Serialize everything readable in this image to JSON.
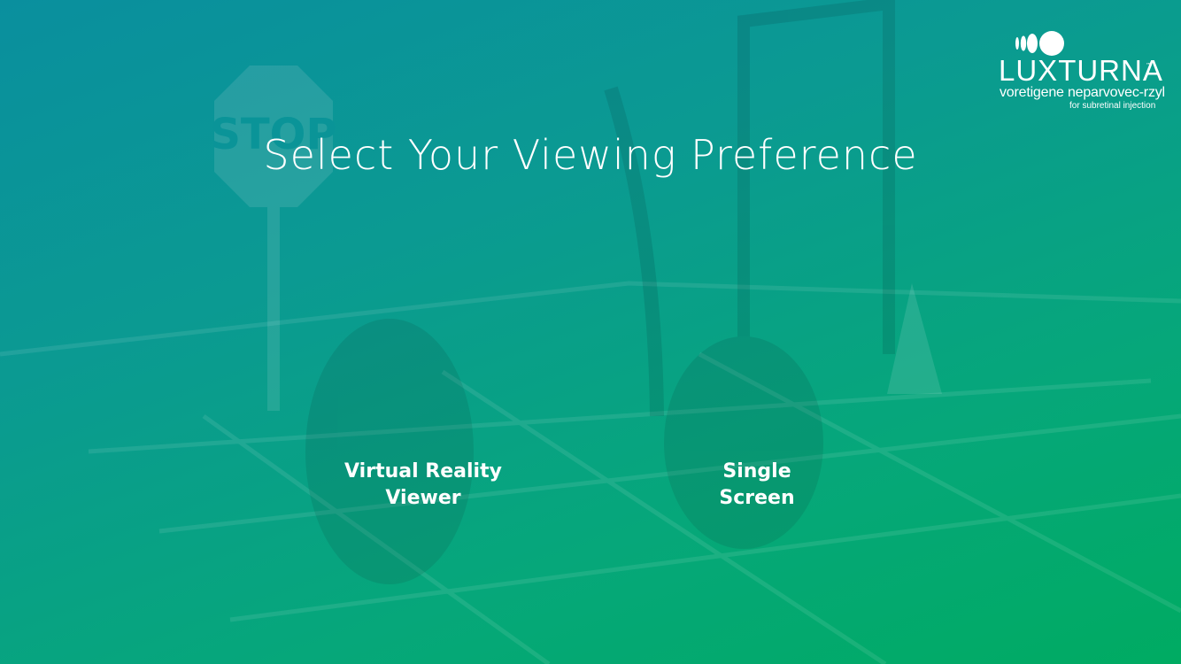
{
  "header": {
    "title": "Select Your Viewing Preference"
  },
  "logo": {
    "brand": "LUXTURNA",
    "trademark": "™",
    "generic_name": "voretigene neparvovec-rzyl",
    "route": "for subretinal injection",
    "mark_icon": "luxturna-circles-icon"
  },
  "background": {
    "sign_text": "STOP",
    "icon": "vr-mobility-course-room-image"
  },
  "options": {
    "vr": {
      "line1": "Virtual Reality",
      "line2": "Viewer"
    },
    "single": {
      "line1": "Single",
      "line2": "Screen"
    }
  },
  "colors": {
    "gradient_start": "#0a8f9e",
    "gradient_end": "#00ab62",
    "text": "#ffffff"
  }
}
